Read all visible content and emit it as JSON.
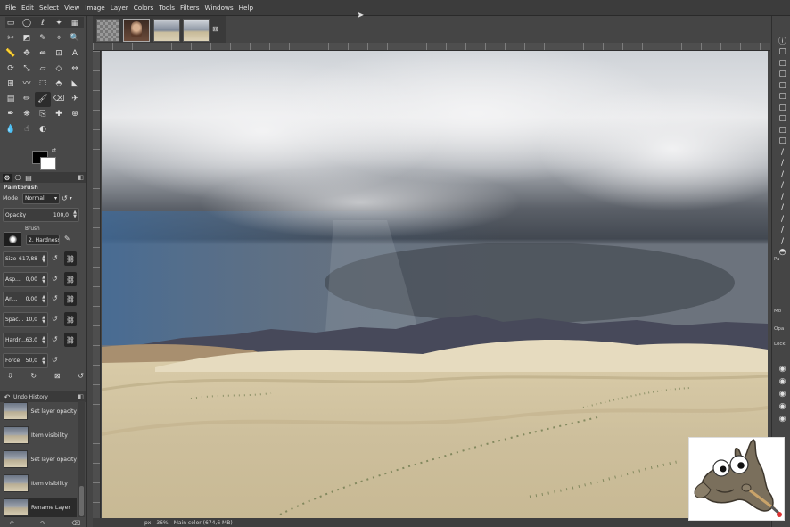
{
  "menu": [
    "File",
    "Edit",
    "Select",
    "View",
    "Image",
    "Layer",
    "Colors",
    "Tools",
    "Filters",
    "Windows",
    "Help"
  ],
  "toolbox": {
    "tool_icons": [
      "rect-select-icon",
      "ellipse-select-icon",
      "free-select-icon",
      "fuzzy-select-icon",
      "color-select-icon",
      "scissors-select-icon",
      "foreground-select-icon",
      "paths-icon",
      "color-picker-icon",
      "zoom-icon",
      "measure-icon",
      "move-icon",
      "align-icon",
      "crop-icon",
      "text-tool-icon",
      "rotate-icon",
      "scale-icon",
      "shear-icon",
      "perspective-icon",
      "flip-icon",
      "cage-icon",
      "warp-icon",
      "unified-transform-icon",
      "handle-transform-icon",
      "bucket-fill-icon",
      "gradient-icon",
      "pencil-icon",
      "paintbrush-icon",
      "eraser-icon",
      "airbrush-icon",
      "ink-icon",
      "mypaint-brush-icon",
      "clone-icon",
      "heal-icon",
      "perspective-clone-icon",
      "blur-icon",
      "smudge-icon",
      "dodge-burn-icon"
    ],
    "tool_glyphs": [
      "▭",
      "◯",
      "ℓ",
      "✦",
      "▦",
      "✂",
      "◩",
      "✎",
      "⌖",
      "🔍",
      "📏",
      "✥",
      "⇹",
      "⊡",
      "A",
      "⟳",
      "⤡",
      "▱",
      "◇",
      "⇔",
      "⊞",
      "〰",
      "⬚",
      "⬘",
      "◣",
      "▤",
      "✏",
      "🖌",
      "⌫",
      "✈",
      "✒",
      "❋",
      "⎘",
      "✚",
      "⊕",
      "💧",
      "☝",
      "◐"
    ],
    "selected_tool": 27
  },
  "tool_options": {
    "title": "Paintbrush",
    "mode_label": "Mode",
    "mode_value": "Normal",
    "opacity_label": "Opacity",
    "opacity_value": "100,0",
    "brush_label": "Brush",
    "brush_value": "2. Hardness 0",
    "size_label": "Size",
    "size_value": "617,88",
    "aspect_label": "Asp...",
    "aspect_value": "0,00",
    "angle_label": "An...",
    "angle_value": "0,00",
    "spacing_label": "Spac...",
    "spacing_value": "10,0",
    "hardness_label": "Hardn...",
    "hardness_value": "63,0",
    "force_label": "Force",
    "force_value": "50,0"
  },
  "undo_history": {
    "title": "Undo History",
    "items": [
      "Set layer opacity",
      "Item visibility",
      "Set layer opacity",
      "Item visibility",
      "Rename Layer"
    ],
    "selected_index": 4
  },
  "status": {
    "unit": "px",
    "zoom": "36%",
    "info": "Main color (674,6 MB)"
  },
  "right_dock": {
    "labels": [
      "Pa",
      "Mo",
      "Opa",
      "Lock"
    ]
  },
  "colors": {
    "fg": "#000000",
    "bg": "#ffffff",
    "ui_bg": "#454545"
  }
}
